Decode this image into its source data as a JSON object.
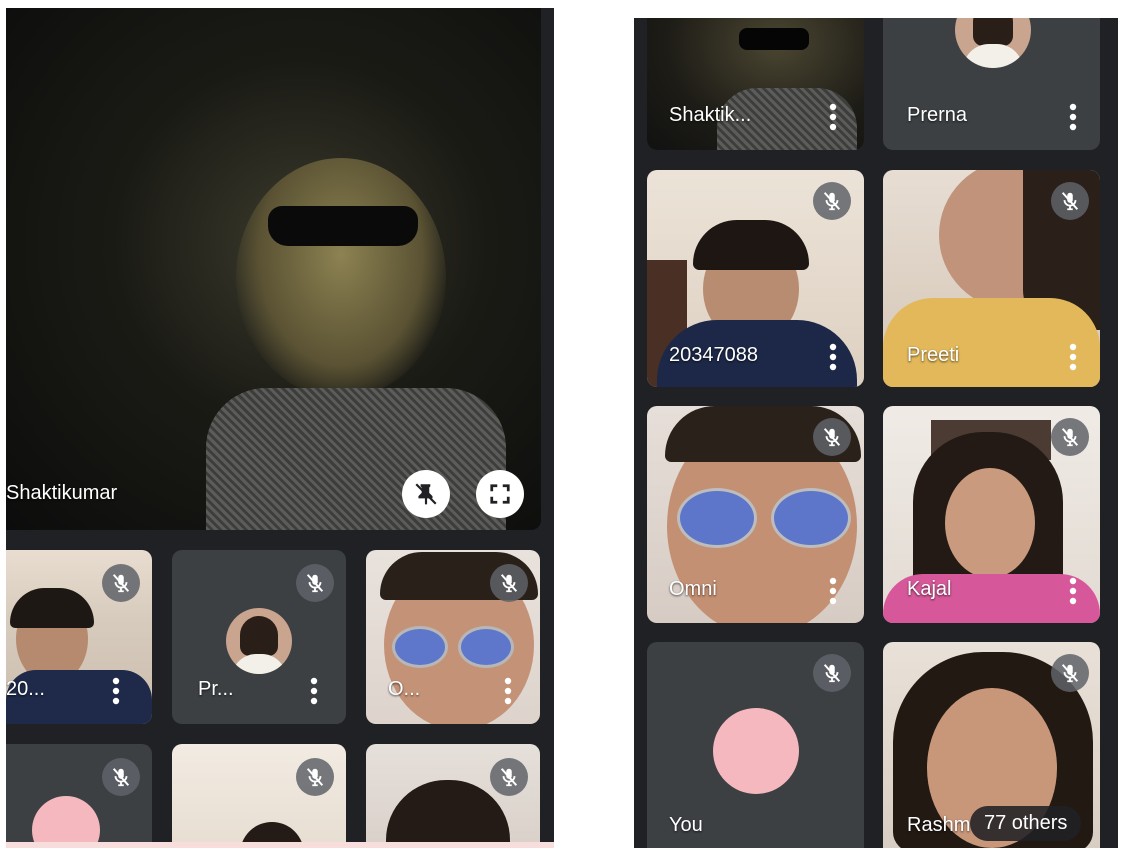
{
  "left_panel": {
    "featured": {
      "name": "Shaktikumar"
    },
    "tiles": [
      {
        "name": "20..."
      },
      {
        "name": "Pr..."
      },
      {
        "name": "O..."
      }
    ]
  },
  "right_panel": {
    "tiles": [
      {
        "name": "Shaktik..."
      },
      {
        "name": "Prerna"
      },
      {
        "name": "20347088"
      },
      {
        "name": "Preeti"
      },
      {
        "name": "Omni"
      },
      {
        "name": "Kajal"
      },
      {
        "name": "You"
      },
      {
        "name": "Rashm"
      }
    ],
    "others_label": "77 others"
  },
  "icons": {
    "muted": "mic-off-icon",
    "menu": "more-vert-icon",
    "pin": "unpin-icon",
    "fullscreen": "fullscreen-icon"
  },
  "colors": {
    "background": "#202124",
    "tile": "#3c4043",
    "you_avatar": "#f4b8be",
    "mute_badge": "#5f6368"
  }
}
